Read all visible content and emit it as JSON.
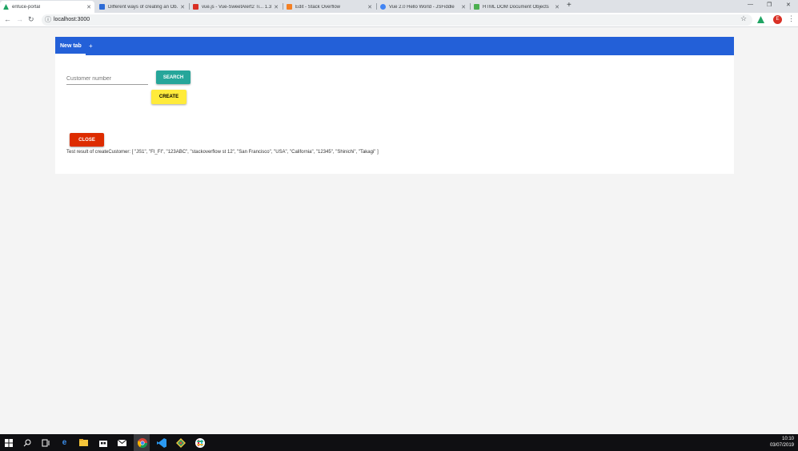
{
  "browser": {
    "tabs": [
      {
        "title": "enfuce-portal",
        "favicon_color": "#1fa463",
        "active": true
      },
      {
        "title": "Different ways of creating an Ob...",
        "favicon_color": "#2d6bd6",
        "active": false
      },
      {
        "title": "vue.js - Vue-SweetAlert2 Ti... 1.30",
        "favicon_color": "#d93025",
        "active": false
      },
      {
        "title": "Edit - Stack Overflow",
        "favicon_color": "#f48024",
        "active": false
      },
      {
        "title": "Vue 2.0 Hello World - JSFiddle",
        "favicon_color": "#4285f4",
        "active": false
      },
      {
        "title": "HTML DOM Document Objects",
        "favicon_color": "#4caf50",
        "active": false
      }
    ],
    "new_tab_symbol": "+",
    "close_symbol": "✕",
    "window_controls": {
      "minimize": "—",
      "restore": "❐",
      "close": "✕"
    },
    "url": "localhost:3000",
    "profile_initial": "E"
  },
  "app": {
    "tab_label": "New tab",
    "add_tab_symbol": "+",
    "customer_placeholder": "Customer number",
    "search_label": "SEARCH",
    "create_label": "CREATE",
    "close_label": "CLOSE",
    "result_text": "Test result of createCustomer: [ \"JS1\", \"FI_FI\", \"123ABC\", \"stackoverflow st 12\", \"San Francisco\", \"USA\", \"California\", \"12345\", \"Shinichi\", \"Takagi\" ]"
  },
  "taskbar": {
    "icons": [
      "windows-start-icon",
      "search-icon",
      "task-view-icon",
      "edge-icon",
      "file-explorer-icon",
      "store-icon",
      "mail-icon",
      "chrome-icon",
      "vscode-icon",
      "gitkraken-icon",
      "slack-icon"
    ],
    "time": "10:10",
    "date": "03/07/2019"
  },
  "colors": {
    "appbar": "#2360d8",
    "search_button": "#26a69a",
    "create_button": "#ffeb3b",
    "close_button": "#dd2c00"
  }
}
